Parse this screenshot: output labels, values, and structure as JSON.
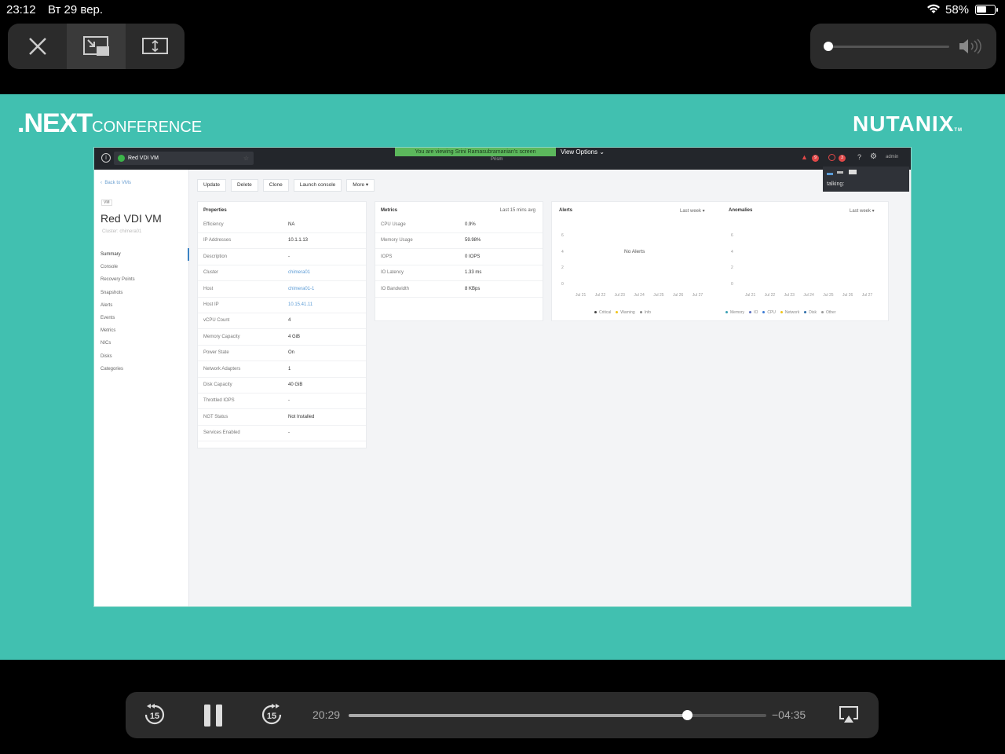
{
  "status_bar": {
    "time": "23:12",
    "date": "Вт 29 вер.",
    "battery": "58%"
  },
  "top_controls": {
    "close_icon": "close-icon",
    "pip_icon": "picture-in-picture-icon",
    "fit_icon": "aspect-fit-icon"
  },
  "volume": {
    "level": 0.0
  },
  "video": {
    "logo_left_main": ".NEXT",
    "logo_left_sub": "CONFERENCE",
    "logo_right": "NUTANIX",
    "logo_right_tm": "TM"
  },
  "prism": {
    "tab_title": "Red VDI VM",
    "share_banner": "You are viewing Srini Ramasubramanian's screen",
    "view_options": "View Options",
    "prism_label": "Prism",
    "alert_count_1": "9",
    "alert_count_2": "3",
    "help": "?",
    "user": "admin",
    "talking_label": "talking:",
    "back_link": "Back to VMs",
    "vm_tag": "VM",
    "vm_name": "Red VDI VM",
    "vm_cluster": "Cluster: chimera01",
    "nav": [
      "Summary",
      "Console",
      "Recovery Points",
      "Snapshots",
      "Alerts",
      "Events",
      "Metrics",
      "NICs",
      "Disks",
      "Categories"
    ],
    "actions": [
      "Update",
      "Delete",
      "Clone",
      "Launch console",
      "More"
    ],
    "properties_title": "Properties",
    "properties": [
      {
        "k": "Efficiency",
        "v": "NA"
      },
      {
        "k": "IP Addresses",
        "v": "10.1.1.13"
      },
      {
        "k": "Description",
        "v": "-"
      },
      {
        "k": "Cluster",
        "v": "chimera01"
      },
      {
        "k": "Host",
        "v": "chimera01-1"
      },
      {
        "k": "Host IP",
        "v": "10.15.41.11"
      },
      {
        "k": "vCPU Count",
        "v": "4"
      },
      {
        "k": "Memory Capacity",
        "v": "4 GiB"
      },
      {
        "k": "Power State",
        "v": "On"
      },
      {
        "k": "Network Adapters",
        "v": "1"
      },
      {
        "k": "Disk Capacity",
        "v": "40 GiB"
      },
      {
        "k": "Throttled IOPS",
        "v": "-"
      },
      {
        "k": "NGT Status",
        "v": "Not Installed"
      },
      {
        "k": "Services Enabled",
        "v": "-"
      }
    ],
    "metrics_title": "Metrics",
    "metrics_sub": "Last 15 mins avg",
    "metrics": [
      {
        "k": "CPU Usage",
        "v": "0.9%"
      },
      {
        "k": "Memory Usage",
        "v": "59.98%"
      },
      {
        "k": "IOPS",
        "v": "0 IOPS"
      },
      {
        "k": "IO Latency",
        "v": "1.33 ms"
      },
      {
        "k": "IO Bandwidth",
        "v": "8 KBps"
      }
    ],
    "alerts_title": "Alerts",
    "alerts_range": "Last week",
    "no_alerts": "No Alerts",
    "anomalies_title": "Anomalies",
    "anomalies_range": "Last week",
    "y_ticks": [
      "6",
      "4",
      "2",
      "0"
    ],
    "x_ticks": [
      "Jul 21",
      "Jul 22",
      "Jul 23",
      "Jul 24",
      "Jul 25",
      "Jul 26",
      "Jul 27"
    ],
    "alerts_legend": [
      {
        "label": "Critical",
        "color": "#444444"
      },
      {
        "label": "Warning",
        "color": "#f0c419"
      },
      {
        "label": "Info",
        "color": "#888888"
      }
    ],
    "anomalies_legend": [
      {
        "label": "Memory",
        "color": "#3aa0b3"
      },
      {
        "label": "IO",
        "color": "#5b6fbf"
      },
      {
        "label": "CPU",
        "color": "#3a7bd5"
      },
      {
        "label": "Network",
        "color": "#f0c419"
      },
      {
        "label": "Disk",
        "color": "#2d6ea8"
      },
      {
        "label": "Other",
        "color": "#999999"
      }
    ]
  },
  "player": {
    "current_time": "20:29",
    "remaining_time": "−04:35",
    "progress": 0.81,
    "skip_back": "15",
    "skip_fwd": "15"
  },
  "colors": {
    "teal": "#41c0b0",
    "accent_blue": "#3b82c4",
    "banner_green": "#5cb85c"
  }
}
